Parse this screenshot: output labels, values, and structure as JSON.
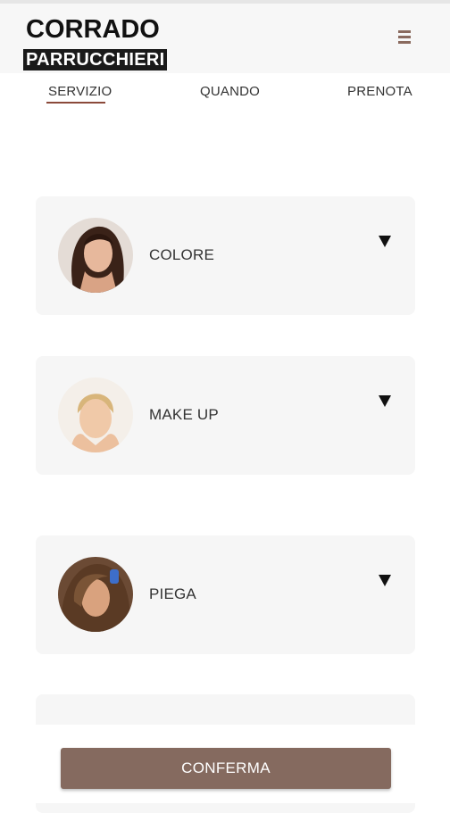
{
  "brand": {
    "name_top": "CORRADO",
    "name_bottom": "PARRUCCHIERI"
  },
  "header": {
    "menu_icon": "hamburger-menu-icon"
  },
  "tabs": [
    {
      "label": "SERVIZIO",
      "active": true
    },
    {
      "label": "QUANDO",
      "active": false
    },
    {
      "label": "PRENOTA",
      "active": false
    }
  ],
  "services": [
    {
      "label": "COLORE",
      "icon": "chevron-down-icon"
    },
    {
      "label": "MAKE UP",
      "icon": "chevron-down-icon"
    },
    {
      "label": "PIEGA",
      "icon": "chevron-down-icon"
    }
  ],
  "footer": {
    "confirm_label": "CONFERMA"
  },
  "colors": {
    "accent": "#856a5f",
    "tab_underline": "#8b4a3a",
    "card_bg": "#f6f6f6"
  }
}
